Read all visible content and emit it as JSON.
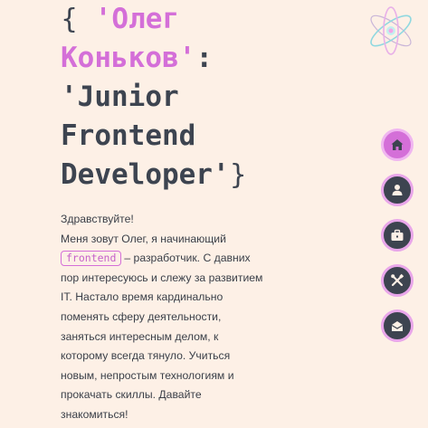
{
  "hero": {
    "open_brace": "{",
    "name_line1": "'Олег",
    "name_line2": "Коньков'",
    "colon": ":",
    "role_line1": "'Junior",
    "role_line2": "Frontend",
    "role_line3": "Developer'",
    "close_brace": "}"
  },
  "intro": {
    "greeting": "Здравствуйте!",
    "line_before_tag": "Меня зовут Олег, я начинающий",
    "tag": "frontend",
    "text_after_tag": "– разработчик. С давних пор интересуюсь и слежу за развитием IT. Настало время кардинально поменять сферу деятельности, заняться интересным делом, к которому всегда тянуло. Учиться новым, непростым технологиям и прокачать скиллы. Давайте знакомиться!"
  },
  "logo": {
    "icon": "atom-logo-icon"
  },
  "nav": {
    "items": [
      {
        "icon": "home-icon",
        "active": true
      },
      {
        "icon": "user-icon",
        "active": false
      },
      {
        "icon": "briefcase-icon",
        "active": false
      },
      {
        "icon": "tools-icon",
        "active": false
      },
      {
        "icon": "mail-open-icon",
        "active": false
      }
    ]
  },
  "colors": {
    "background": "#fdf0e6",
    "text": "#3d4450",
    "accent": "#d46fd8"
  }
}
